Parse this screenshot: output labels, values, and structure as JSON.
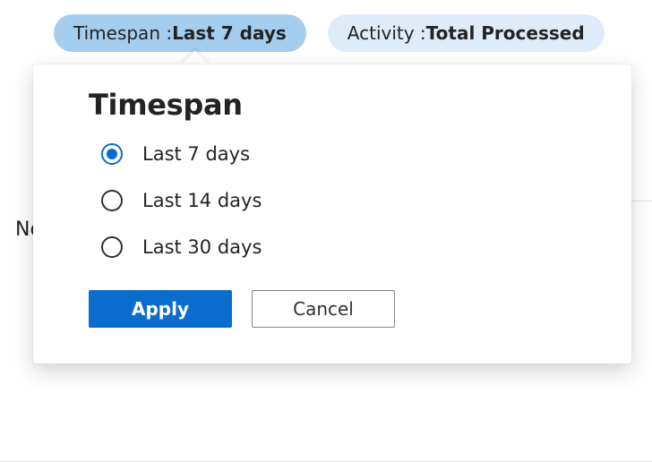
{
  "pills": {
    "timespan": {
      "label": "Timespan : ",
      "value": "Last 7 days"
    },
    "activity": {
      "label": "Activity : ",
      "value": "Total Processed"
    }
  },
  "background": {
    "truncated_text": "No"
  },
  "popover": {
    "title": "Timespan",
    "options": [
      {
        "label": "Last 7 days",
        "selected": true
      },
      {
        "label": "Last 14 days",
        "selected": false
      },
      {
        "label": "Last 30 days",
        "selected": false
      }
    ],
    "apply_label": "Apply",
    "cancel_label": "Cancel"
  },
  "colors": {
    "accent": "#0b6cce"
  }
}
